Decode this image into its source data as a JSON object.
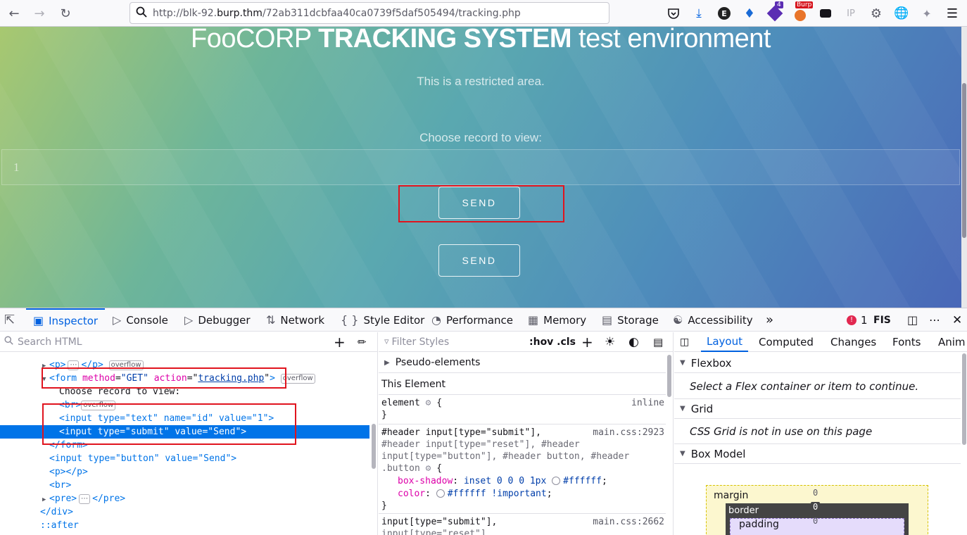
{
  "browser": {
    "url_prefix": "http://blk-92.",
    "url_host": "burp.thm",
    "url_path": "/72ab311dcbfaa40ca0739f5daf505494/tracking.php",
    "extension_badge_count": "4",
    "burp_badge": "Burp",
    "ip_label": "IP"
  },
  "page": {
    "title_prefix": "FooCORP ",
    "title_bold": "TRACKING SYSTEM",
    "title_suffix": " test environment",
    "restricted_text": "This is a restricted area.",
    "choose_label": "Choose record to view:",
    "input_value": "1",
    "send_submit_label": "SEND",
    "send_button_label": "SEND"
  },
  "devtools": {
    "tabs": [
      "Inspector",
      "Console",
      "Debugger",
      "Network",
      "Style Editor",
      "Performance",
      "Memory",
      "Storage",
      "Accessibility"
    ],
    "error_count": "1",
    "locale_label": "FIS",
    "search_placeholder": "Search HTML",
    "filter_placeholder": "Filter Styles",
    "pseudo_toggle": ":hov .cls"
  },
  "markup": {
    "overflow_badge": "overflow",
    "lines": {
      "form_tag": "form",
      "form_method_attr": "method",
      "form_method_val": "\"GET\"",
      "form_action_attr": "action",
      "form_action_val": "tracking.php",
      "choose_text": "Choose record to view:",
      "input1": "<input type=\"text\" name=\"id\" value=\"1\">",
      "input2": "<input type=\"submit\" value=\"Send\">",
      "close_form": "</form>",
      "input3": "<input type=\"button\" value=\"Send\">",
      "p_empty": "<p></p>",
      "br": "<br>",
      "pre": "</pre>",
      "close_div": "</div>",
      "after": "::after"
    }
  },
  "rules": {
    "pseudo_elements": "Pseudo-elements",
    "this_element": "This Element",
    "element_selector": "element",
    "element_source": "inline",
    "rule1_selector_1": "#header input[type=\"submit\"],",
    "rule1_source": "main.css:2923",
    "rule1_selector_2": "#header input[type=\"reset\"], #header",
    "rule1_selector_3": "input[type=\"button\"], #header button, #header",
    "rule1_selector_4": ".button",
    "prop1_name": "box-shadow",
    "prop1_value": "inset 0 0 0 1px",
    "prop1_color": "#ffffff",
    "prop2_name": "color",
    "prop2_value": "#ffffff !important",
    "rule2_selector_1": "input[type=\"submit\"],",
    "rule2_source": "main.css:2662",
    "rule2_selector_2": "input[type=\"reset\"],"
  },
  "layout_panel": {
    "tabs": [
      "Layout",
      "Computed",
      "Changes",
      "Fonts",
      "Anim"
    ],
    "flexbox_label": "Flexbox",
    "flexbox_msg": "Select a Flex container or item to continue.",
    "grid_label": "Grid",
    "grid_msg": "CSS Grid is not in use on this page",
    "box_model_label": "Box Model",
    "margin_label": "margin",
    "border_label": "border",
    "padding_label": "padding",
    "margin_top": "0",
    "border_top": "0",
    "padding_top": "0"
  }
}
